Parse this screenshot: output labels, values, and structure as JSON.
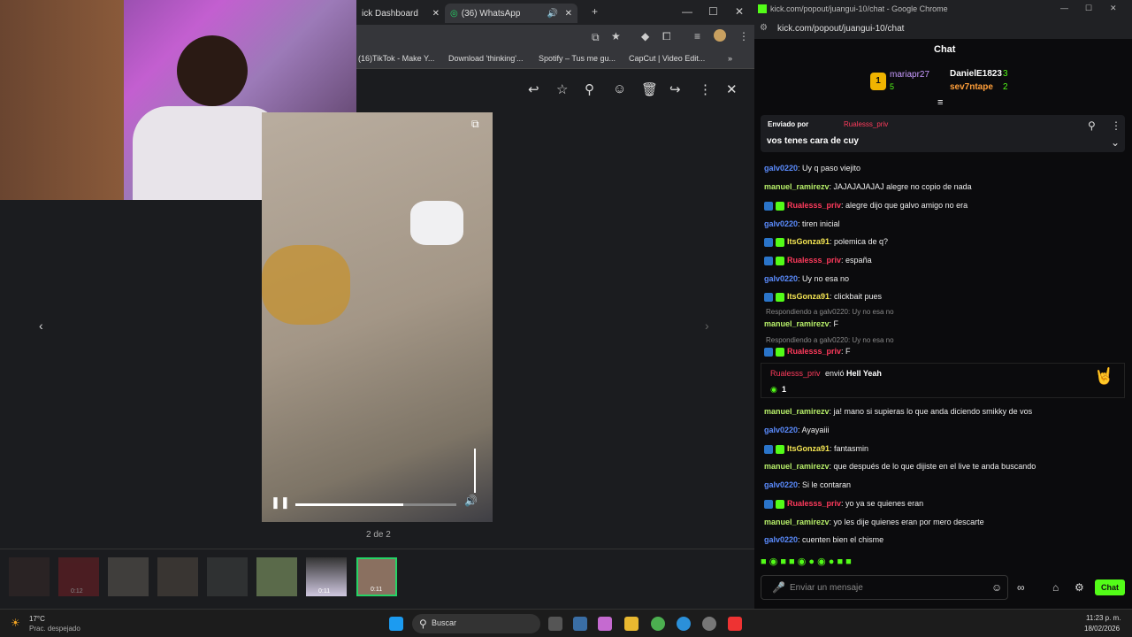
{
  "browser_left": {
    "tabs": [
      {
        "label": "ick Dashboard"
      },
      {
        "label": "(36) WhatsApp"
      }
    ],
    "bookmarks": [
      "(16)TikTok - Make Y...",
      "Download 'thinking'...",
      "Spotify – Tus me gu...",
      "CapCut | Video Edit..."
    ],
    "viewer": {
      "counter": "2 de 2",
      "thumb_durations": [
        "0:12",
        "0:11",
        "0:11"
      ]
    }
  },
  "browser_right": {
    "window_title": "kick.com/popout/juangui-10/chat - Google Chrome",
    "url": "kick.com/popout/juangui-10/chat",
    "chat_title": "Chat",
    "leaderboard": [
      {
        "rank": "1",
        "name": "mariapr27",
        "count": "5"
      },
      {
        "name": "DanielE1823",
        "count": "3"
      },
      {
        "name": "sev7ntape",
        "count": "2"
      }
    ],
    "pinned": {
      "prefix": "Enviado por",
      "user": "Rualesss_priv",
      "text": "vos tenes cara de cuy"
    },
    "messages": [
      {
        "user": "galv0220",
        "text": ": Uy q paso viejito",
        "color": "#5b8cff"
      },
      {
        "user": "manuel_ramirezv",
        "text": ": JAJAJAJAJAJ alegre no copio de nada",
        "color": "#b8f06a"
      },
      {
        "user": "Rualesss_priv",
        "text": ": alegre dijo que galvo amigo no era",
        "color": "#ff3b5c"
      },
      {
        "user": "galv0220",
        "text": ": tiren inicial",
        "color": "#5b8cff"
      },
      {
        "user": "ItsGonza91",
        "text": ": polemica de q?",
        "color": "#f5e653"
      },
      {
        "user": "Rualesss_priv",
        "text": ": españa",
        "color": "#ff3b5c"
      },
      {
        "user": "galv0220",
        "text": ": Uy no esa no",
        "color": "#5b8cff"
      },
      {
        "user": "ItsGonza91",
        "text": ": clickbait pues",
        "color": "#f5e653"
      },
      {
        "user": "manuel_ramirezv",
        "text": ": F",
        "color": "#b8f06a"
      },
      {
        "user": "Rualesss_priv",
        "text": ": F",
        "color": "#ff3b5c"
      },
      {
        "user": "manuel_ramirezv",
        "text": ": ja! mano si supieras lo que anda diciendo smikky de vos",
        "color": "#b8f06a"
      },
      {
        "user": "galv0220",
        "text": ": Ayayaiii",
        "color": "#5b8cff"
      },
      {
        "user": "ItsGonza91",
        "text": ": fantasmin",
        "color": "#f5e653"
      },
      {
        "user": "manuel_ramirezv",
        "text": ": que después de lo que dijiste en el live te anda buscando",
        "color": "#b8f06a"
      },
      {
        "user": "galv0220",
        "text": ": Si le contaran",
        "color": "#5b8cff"
      },
      {
        "user": "Rualesss_priv",
        "text": ": yo ya se quienes eran",
        "color": "#ff3b5c"
      },
      {
        "user": "manuel_ramirezv",
        "text": ": yo les dije quienes eran por mero descarte",
        "color": "#b8f06a"
      },
      {
        "user": "galv0220",
        "text": ": cuenten bien el chisme",
        "color": "#5b8cff"
      }
    ],
    "replies": [
      "Respondiendo a galv0220: Uy no esa no",
      "Respondiendo a galv0220: Uy no esa no"
    ],
    "gift": {
      "user": "Rualesss_priv",
      "verb": "envió",
      "item": "Hell Yeah",
      "count": "1"
    },
    "input_placeholder": "Enviar un mensaje",
    "send_label": "Chat"
  },
  "taskbar": {
    "temp": "17°C",
    "weather": "Prac. despejado",
    "search": "Buscar",
    "time": "11:23 p. m.",
    "date": "18/02/2026"
  }
}
